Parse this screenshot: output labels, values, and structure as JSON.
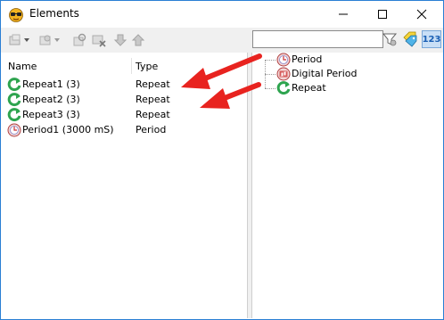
{
  "window": {
    "title": "Elements"
  },
  "toolbar": {
    "tools": [
      "add-element-icon",
      "add-period-icon",
      "refresh-icon",
      "delete-icon",
      "move-down-icon",
      "move-up-icon"
    ],
    "search_value": "",
    "right_tools": [
      "filter-icon",
      "tags-icon",
      "numbering-icon"
    ],
    "numbering_label": "123"
  },
  "list": {
    "columns": [
      "Name",
      "Type"
    ],
    "rows": [
      {
        "name": "Repeat1 (3)",
        "type": "Repeat",
        "icon": "repeat-icon"
      },
      {
        "name": "Repeat2 (3)",
        "type": "Repeat",
        "icon": "repeat-icon"
      },
      {
        "name": "Repeat3 (3)",
        "type": "Repeat",
        "icon": "repeat-icon"
      },
      {
        "name": "Period1 (3000 mS)",
        "type": "Period",
        "icon": "period-icon"
      }
    ]
  },
  "tree": {
    "items": [
      {
        "label": "Period",
        "icon": "period-icon"
      },
      {
        "label": "Digital Period",
        "icon": "digital-period-icon"
      },
      {
        "label": "Repeat",
        "icon": "repeat-icon"
      }
    ]
  },
  "colors": {
    "accent": "#2a7fd4",
    "annotation": "#e8231f",
    "repeat_green": "#2ea44f"
  }
}
